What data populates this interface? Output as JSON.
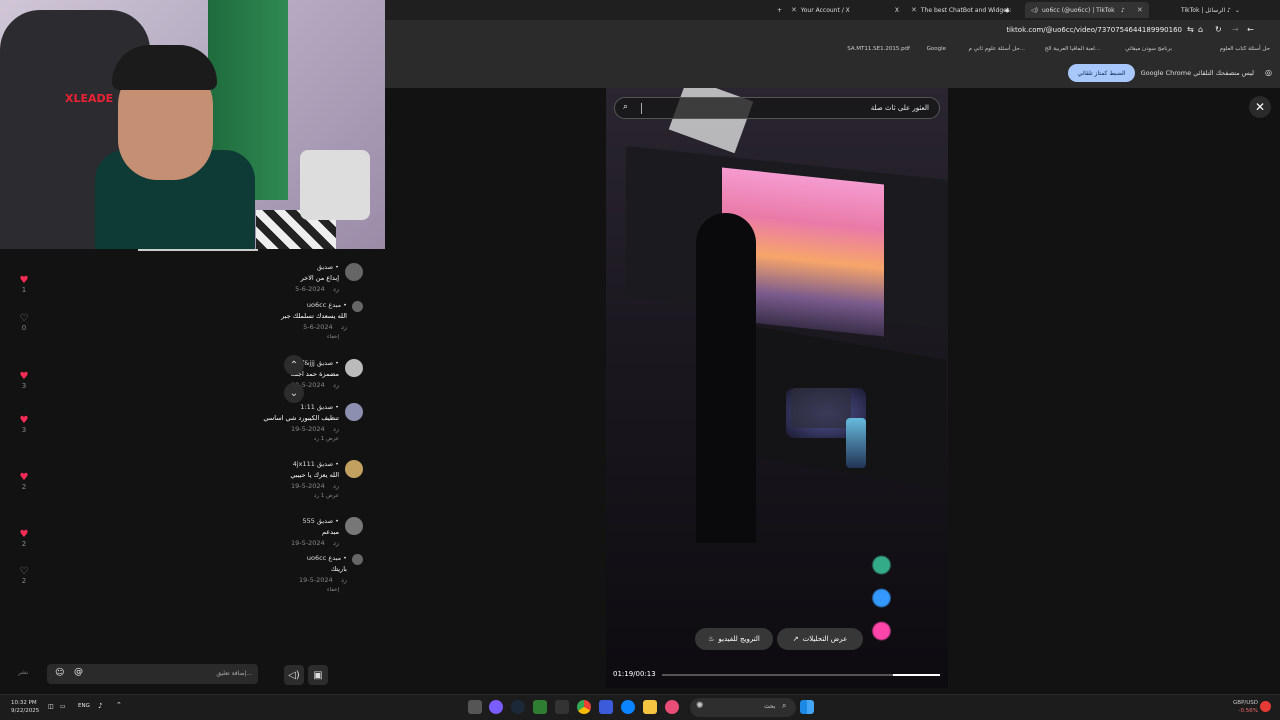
{
  "tabs": [
    {
      "label": "Your Account / X"
    },
    {
      "label": "The best ChatBot and Widget:"
    },
    {
      "label": "uo6cc (@uo6cc) | TikTok",
      "active": true
    },
    {
      "label": "TikTok | الرسائل"
    }
  ],
  "address": {
    "url": "tiktok.com/@uo6cc/video/7370754644189990160"
  },
  "bookmarks": [
    "حل أسئلة كتاب العلوم",
    "برنامج سودن ميقاتي",
    "لعبة الماقيا العربية الح...",
    "حل أسئلة علوم ثاني م...",
    "Google",
    "SA.MT11.SE1.2015.pdf"
  ],
  "infobar": {
    "text": "Google Chrome ليس متصفحك التلقائي",
    "button": "الضبط كمتاز تلقائي"
  },
  "video": {
    "search_text": "العثور على ثاث صلة",
    "promote_label": "الترويج للفيديو",
    "analytics_label": "عرض التحليلات",
    "time": "01:19/00:13",
    "progress": 0.17
  },
  "comments": [
    {
      "name": "صديق •",
      "text": "إبداع من الاخر",
      "date": "2024-6-5",
      "reply": "رد",
      "likes": "1",
      "liked": true
    },
    {
      "name": "uo6cc مبدع •",
      "text": "الله يسعدك تسلملك جبر",
      "date": "2024-6-5",
      "reply": "رد",
      "likes": "0",
      "liked": false,
      "is_reply": true,
      "hide": "إخفاء"
    },
    {
      "name": "@dff&jjj صديق •",
      "text": "مضمزة حمد اجئك",
      "date": "2024-5-19",
      "reply": "رد",
      "likes": "3",
      "liked": true
    },
    {
      "name": "1:11 صديق •",
      "text": "تنظيف الكيبورد شي اساسي",
      "date": "2024-5-19",
      "reply": "رد",
      "likes": "3",
      "liked": true,
      "more": "عرض 1 رد"
    },
    {
      "name": "4jx111 صديق •",
      "text": "الله يعزك يا حبيبي",
      "date": "2024-5-19",
      "reply": "رد",
      "likes": "2",
      "liked": true,
      "more": "عرض 1 رد"
    },
    {
      "name": "555 صديق •",
      "text": "مبدعم",
      "date": "2024-5-19",
      "reply": "رد",
      "likes": "2",
      "liked": true
    },
    {
      "name": "uo6cc مبدع •",
      "text": "باريتك",
      "date": "2024-5-19",
      "reply": "رد",
      "likes": "2",
      "liked": false,
      "is_reply": true,
      "hide": "إخفاء"
    }
  ],
  "input": {
    "placeholder": "إضافة تعليق...",
    "post": "نشر"
  },
  "taskbar": {
    "time": "10:32 PM",
    "date": "9/22/2025",
    "lang": "ENG",
    "search": "بحث",
    "fx_pair": "GBP/USD",
    "fx_change": "-0.56%"
  },
  "colors": {
    "like_active": "#fe2c55",
    "infobar_button": "#a8c7fa"
  }
}
